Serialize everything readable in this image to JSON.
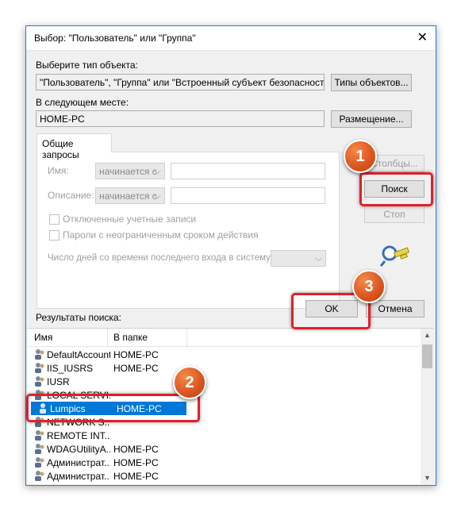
{
  "window": {
    "title": "Выбор: \"Пользователь\" или \"Группа\"",
    "close_glyph": "✕"
  },
  "object_type": {
    "label": "Выберите тип объекта:",
    "value": "\"Пользователь\", \"Группа\" или \"Встроенный субъект безопасности\"",
    "button": "Типы объектов..."
  },
  "location": {
    "label": "В следующем месте:",
    "value": "HOME-PC",
    "button": "Размещение..."
  },
  "tab": {
    "label": "Общие запросы"
  },
  "query": {
    "name_label": "Имя:",
    "name_mode": "начинается с",
    "desc_label": "Описание:",
    "desc_mode": "начинается с",
    "disabled_accounts": "Отключенные учетные записи",
    "no_expire": "Пароли с неограниченным сроком действия",
    "days_label": "Число дней со времени последнего входа в систему:"
  },
  "buttons": {
    "columns": "Столбцы...",
    "search": "Поиск",
    "stop": "Стоп",
    "ok": "OK",
    "cancel": "Отмена"
  },
  "results": {
    "label": "Результаты поиска:",
    "headers": {
      "name": "Имя",
      "folder": "В папке"
    },
    "rows": [
      {
        "name": "DefaultAccount",
        "folder": "HOME-PC"
      },
      {
        "name": "IIS_IUSRS",
        "folder": "HOME-PC"
      },
      {
        "name": "IUSR",
        "folder": ""
      },
      {
        "name": "LOCAL SERVI...",
        "folder": ""
      },
      {
        "name": "Lumpics",
        "folder": "HOME-PC",
        "selected": true
      },
      {
        "name": "NETWORK S...",
        "folder": ""
      },
      {
        "name": "REMOTE INT...",
        "folder": ""
      },
      {
        "name": "WDAGUtilityA...",
        "folder": "HOME-PC"
      },
      {
        "name": "Администрат...",
        "folder": "HOME-PC"
      },
      {
        "name": "Администрат...",
        "folder": "HOME-PC"
      }
    ]
  },
  "annotations": {
    "badge1": "1",
    "badge2": "2",
    "badge3": "3",
    "highlight_color": "#e0202a",
    "badge_color": "#d9531e"
  }
}
